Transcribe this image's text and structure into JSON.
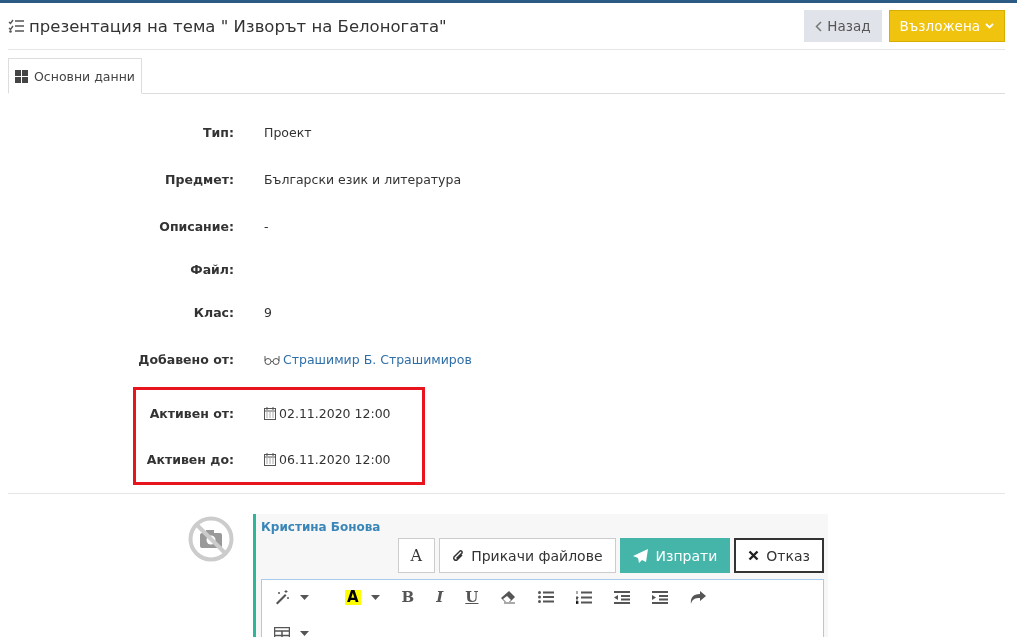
{
  "header": {
    "title": "презентация на тема \" Изворът на Белоногата\"",
    "back_button": "Назад",
    "status_button": "Възложена"
  },
  "tabs": [
    {
      "label": "Основни данни",
      "selected": true
    }
  ],
  "fields": [
    {
      "label": "Тип:",
      "value": "Проект",
      "kind": "text",
      "highlighted": false
    },
    {
      "label": "Предмет:",
      "value": "Български език и литература",
      "kind": "text",
      "highlighted": false
    },
    {
      "label": "Описание:",
      "value": "-",
      "kind": "text",
      "highlighted": false
    },
    {
      "label": "Файл:",
      "kind": "empty",
      "highlighted": false
    },
    {
      "label": "Клас:",
      "value": "9",
      "kind": "text",
      "highlighted": false
    },
    {
      "label": "Добавено от:",
      "value": "Страшимир Б. Страшимиров",
      "kind": "person",
      "highlighted": false
    },
    {
      "label": "Активен от:",
      "value": "02.11.2020 12:00",
      "kind": "date",
      "highlighted": true
    },
    {
      "label": "Активен до:",
      "value": "06.11.2020 12:00",
      "kind": "date",
      "highlighted": true
    }
  ],
  "comment": {
    "author": "Кристина Бонова",
    "font_button": "A",
    "attach_button": "Прикачи файлове",
    "send_button": "Изпрати",
    "cancel_button": "Отказ",
    "toolbar": [
      {
        "kind": "magic"
      },
      {
        "kind": "caret"
      },
      {
        "kind": "highlight",
        "glyph": "A"
      },
      {
        "kind": "caret"
      },
      {
        "kind": "bold",
        "glyph": "B"
      },
      {
        "kind": "italic",
        "glyph": "I"
      },
      {
        "kind": "underline",
        "glyph": "U"
      },
      {
        "kind": "eraser"
      },
      {
        "kind": "ul"
      },
      {
        "kind": "ol"
      },
      {
        "kind": "outdent"
      },
      {
        "kind": "indent"
      },
      {
        "kind": "redo"
      },
      {
        "kind": "break"
      },
      {
        "kind": "table"
      },
      {
        "kind": "caret"
      }
    ]
  }
}
